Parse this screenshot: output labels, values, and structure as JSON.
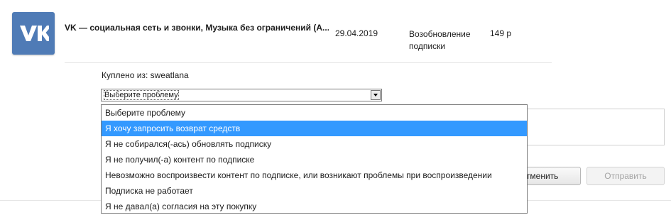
{
  "purchase": {
    "app_icon": "vk-logo-icon",
    "app_title": "VK — социальная сеть и звонки, Музыка без ограничений (А...",
    "date": "29.04.2019",
    "type": "Возобновление подписки",
    "price": "149 р",
    "bought_from": "Куплено из: sweatlana"
  },
  "problem_select": {
    "value": "Выберите проблему",
    "options": [
      "Выберите проблему",
      "Я хочу запросить возврат средств",
      "Я не собирался(-ась) обновлять подписку",
      "Я не получил(-а) контент по подписке",
      "Невозможно воспроизвести контент по подписке, или возникают проблемы при воспроизведении",
      "Подписка не работает",
      "Я не давал(а) согласия на эту покупку"
    ],
    "highlighted_index": 1
  },
  "buttons": {
    "cancel_label": "Отменить",
    "submit_label": "Отправить"
  },
  "colors": {
    "vk_brand": "#4f7bb6",
    "highlight": "#3399ff"
  }
}
